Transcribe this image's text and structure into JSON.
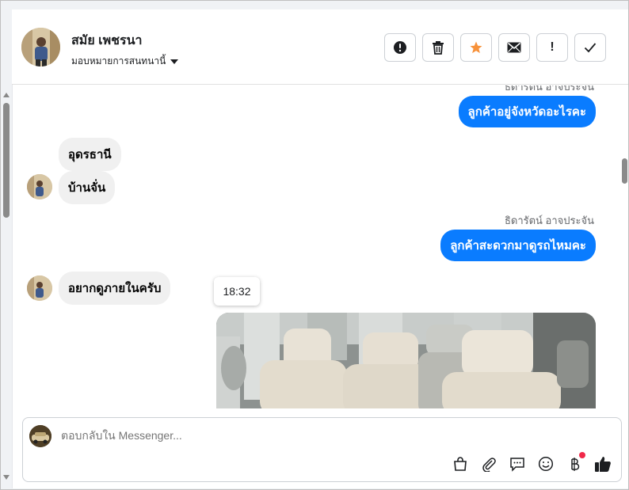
{
  "header": {
    "contact_name": "สมัย เพชรนา",
    "assign_label": "มอบหมายการสนทนานี้",
    "actions": [
      {
        "name": "spam-button",
        "icon": "alert-circle-icon"
      },
      {
        "name": "delete-button",
        "icon": "trash-icon"
      },
      {
        "name": "star-button",
        "icon": "star-icon",
        "color": "#f7923b"
      },
      {
        "name": "mark-unread-button",
        "icon": "envelope-icon"
      },
      {
        "name": "follow-up-button",
        "icon": "exclamation-icon",
        "label": "!"
      },
      {
        "name": "mark-done-button",
        "icon": "check-icon"
      }
    ]
  },
  "chat": {
    "messages": [
      {
        "type": "sender",
        "text": "ธิดารัตน์ อาจประจัน"
      },
      {
        "type": "out",
        "text": "ลูกค้าอยู่จังหวัดอะไรคะ"
      },
      {
        "type": "in",
        "text": "อุดรธานี"
      },
      {
        "type": "in",
        "text": "บ้านจั่น"
      },
      {
        "type": "sender",
        "text": "ธิดารัตน์ อาจประจัน"
      },
      {
        "type": "out",
        "text": "ลูกค้าสะดวกมาดูรถไหมคะ"
      },
      {
        "type": "in",
        "text": "อยากดูภายในครับ"
      },
      {
        "type": "timestamp",
        "text": "18:32"
      },
      {
        "type": "image",
        "alt": "van-interior-photo"
      }
    ]
  },
  "composer": {
    "placeholder": "ตอบกลับใน Messenger..."
  },
  "colors": {
    "outgoing_bubble": "#0a7cff",
    "incoming_bubble": "#f0f0f0",
    "star": "#f7923b",
    "notification_dot": "#f02849"
  }
}
